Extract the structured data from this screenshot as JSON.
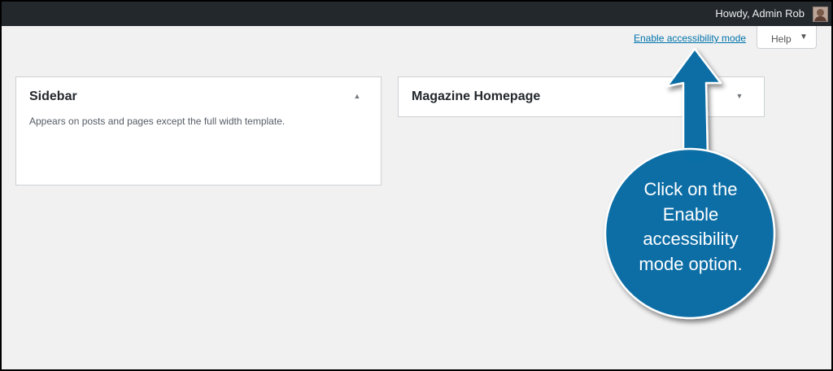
{
  "admin_bar": {
    "greeting": "Howdy, Admin Rob",
    "avatar_icon": "user-avatar-icon"
  },
  "screen_meta": {
    "accessibility_link": "Enable accessibility mode",
    "help_label": "Help",
    "help_caret_icon": "caret-down-icon"
  },
  "widgets": [
    {
      "title": "Sidebar",
      "description": "Appears on posts and pages except the full width template.",
      "state": "expanded",
      "toggle_icon": "caret-up-icon"
    },
    {
      "title": "Magazine Homepage",
      "description": "",
      "state": "collapsed",
      "toggle_icon": "caret-down-icon"
    }
  ],
  "annotation": {
    "lines": [
      "Click on the",
      "Enable",
      "accessibility",
      "mode option."
    ],
    "color": "#0a6ea6"
  },
  "colors": {
    "admin_bar": "#23282d",
    "link": "#0073aa",
    "background": "#f1f1f1"
  }
}
